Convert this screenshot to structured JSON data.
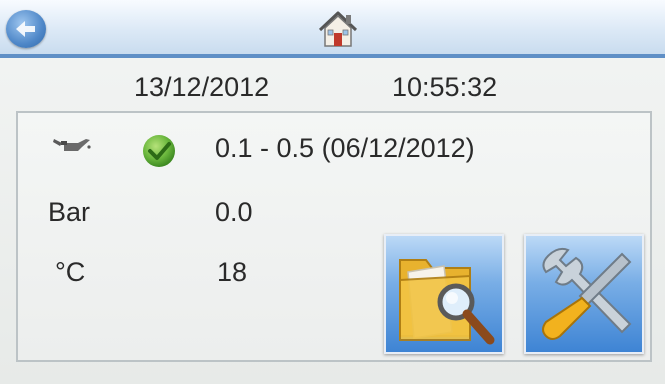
{
  "header": {
    "back_icon": "back-arrow-icon",
    "home_icon": "home-icon"
  },
  "datetime": {
    "date": "13/12/2012",
    "time": "10:55:32"
  },
  "status": {
    "oil_icon": "oil-can-icon",
    "check_icon": "check-ok-icon",
    "interval": "0.1 - 0.5 (06/12/2012)"
  },
  "readings": {
    "pressure_label": "Bar",
    "pressure_value": "0.0",
    "temperature_label": "°C",
    "temperature_value": "18"
  },
  "actions": {
    "search_icon": "folder-search-icon",
    "settings_icon": "tools-icon"
  },
  "colors": {
    "accent": "#5f8fc6",
    "ok_green": "#5aa832",
    "tile_blue": "#3e84d4"
  }
}
